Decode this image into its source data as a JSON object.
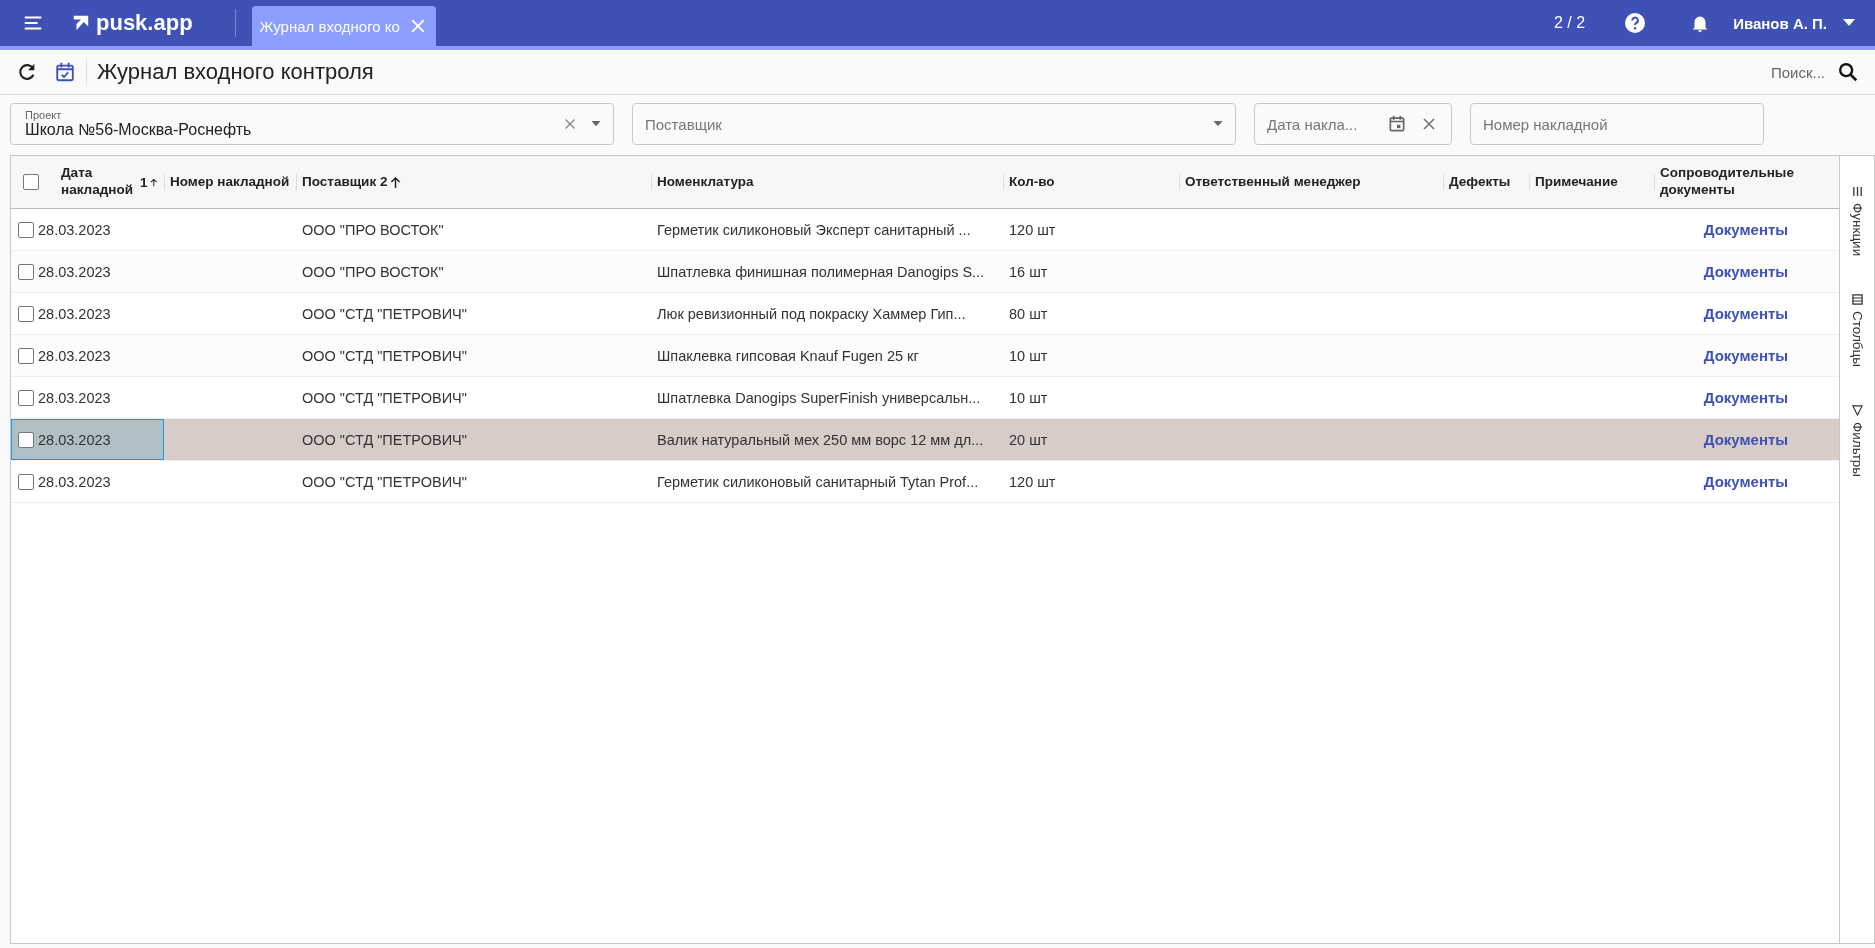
{
  "topbar": {
    "logo": "pusk.app",
    "tab": {
      "label": "Журнал входного ко",
      "selected": true
    },
    "counter": "2 / 2",
    "user": "Иванов А. П."
  },
  "toolbar": {
    "title": "Журнал входного контроля",
    "search_placeholder": "Поиск..."
  },
  "filters": {
    "project": {
      "label": "Проект",
      "value": "Школа №56-Москва-Роснефть"
    },
    "supplier": {
      "placeholder": "Поставщик"
    },
    "date": {
      "placeholder": "Дата накла..."
    },
    "number": {
      "placeholder": "Номер накладной"
    }
  },
  "table": {
    "select_all": {
      "checked": false
    },
    "columns": [
      {
        "label": "Дата накладной",
        "sort": "1"
      },
      {
        "label": "Номер накладной"
      },
      {
        "label": "Поставщик 2",
        "sort_arrow": true
      },
      {
        "label": "Номенклатура"
      },
      {
        "label": "Кол-во"
      },
      {
        "label": "Ответственный менеджер"
      },
      {
        "label": "Дефекты"
      },
      {
        "label": "Примечание"
      },
      {
        "label": "Сопроводительные документы"
      }
    ],
    "rows": [
      {
        "checked": false,
        "selected": false,
        "date": "28.03.2023",
        "supplier": "ООО \"ПРО ВОСТОК\"",
        "item": "Герметик силиконовый Эксперт санитарный ...",
        "qty": "120 шт",
        "docs": "Документы"
      },
      {
        "checked": false,
        "selected": false,
        "date": "28.03.2023",
        "supplier": "ООО \"ПРО ВОСТОК\"",
        "item": "Шпатлевка финишная полимерная Danogips S...",
        "qty": "16 шт",
        "docs": "Документы"
      },
      {
        "checked": false,
        "selected": false,
        "date": "28.03.2023",
        "supplier": "ООО \"СТД \"ПЕТРОВИЧ\"",
        "item": "Люк ревизионный под покраску Хаммер Гип...",
        "qty": "80 шт",
        "docs": "Документы"
      },
      {
        "checked": false,
        "selected": false,
        "date": "28.03.2023",
        "supplier": "ООО \"СТД \"ПЕТРОВИЧ\"",
        "item": "Шпаклевка гипсовая Knauf Fugen 25 кг",
        "qty": "10 шт",
        "docs": "Документы"
      },
      {
        "checked": false,
        "selected": false,
        "date": "28.03.2023",
        "supplier": "ООО \"СТД \"ПЕТРОВИЧ\"",
        "item": "Шпатлевка Danogips SuperFinish универсальн...",
        "qty": "10 шт",
        "docs": "Документы"
      },
      {
        "checked": false,
        "selected": true,
        "date": "28.03.2023",
        "supplier": "ООО \"СТД \"ПЕТРОВИЧ\"",
        "item": "Валик натуральный мех 250 мм ворс 12 мм дл...",
        "qty": "20 шт",
        "docs": "Документы"
      },
      {
        "checked": false,
        "selected": false,
        "date": "28.03.2023",
        "supplier": "ООО \"СТД \"ПЕТРОВИЧ\"",
        "item": "Герметик силиконовый санитарный Tytan Prof...",
        "qty": "120 шт",
        "docs": "Документы"
      }
    ]
  },
  "side_panel": [
    {
      "kind": "functions",
      "label": "Функции"
    },
    {
      "kind": "columns",
      "label": "Столбцы"
    },
    {
      "kind": "filters",
      "label": "Фильтры"
    }
  ]
}
